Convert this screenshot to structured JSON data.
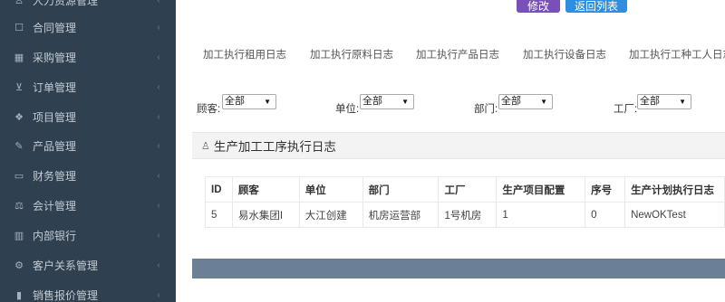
{
  "sidebar": {
    "items": [
      {
        "label": "人力资源管理",
        "icon": "user-icon",
        "glyph": "♙"
      },
      {
        "label": "合同管理",
        "icon": "document-icon",
        "glyph": "☐"
      },
      {
        "label": "采购管理",
        "icon": "archive-icon",
        "glyph": "▦"
      },
      {
        "label": "订单管理",
        "icon": "cart-icon",
        "glyph": "⊻"
      },
      {
        "label": "项目管理",
        "icon": "cubes-icon",
        "glyph": "❖"
      },
      {
        "label": "产品管理",
        "icon": "edit-icon",
        "glyph": "✎"
      },
      {
        "label": "财务管理",
        "icon": "money-icon",
        "glyph": "▭"
      },
      {
        "label": "会计管理",
        "icon": "balance-icon",
        "glyph": "⚖"
      },
      {
        "label": "内部银行",
        "icon": "bank-icon",
        "glyph": "▥"
      },
      {
        "label": "客户关系管理",
        "icon": "cogs-icon",
        "glyph": "⚙"
      },
      {
        "label": "销售报价管理",
        "icon": "chart-icon",
        "glyph": "▮"
      }
    ],
    "chevron": "‹"
  },
  "actions": {
    "edit": "修改",
    "back": "返回列表"
  },
  "tabs": [
    "加工执行租用日志",
    "加工执行原料日志",
    "加工执行产品日志",
    "加工执行设备日志",
    "加工执行工种工人日志"
  ],
  "filters": [
    {
      "label": "顾客:",
      "value": "全部"
    },
    {
      "label": "单位:",
      "value": "全部"
    },
    {
      "label": "部门:",
      "value": "全部"
    },
    {
      "label": "工厂:",
      "value": "全部"
    }
  ],
  "section": {
    "title": "生产加工工序执行日志",
    "icon": "user-icon"
  },
  "table": {
    "headers": [
      "ID",
      "顾客",
      "单位",
      "部门",
      "工厂",
      "生产项目配置",
      "序号",
      "生产计划执行日志"
    ],
    "rows": [
      [
        "5",
        "易水集团I",
        "大江创建",
        "机房运营部",
        "1号机房",
        "1",
        "0",
        "NewOKTest"
      ]
    ]
  },
  "colors": {
    "sidebar": "#2f4050",
    "edit_button": "#7a4fb8",
    "back_button": "#2e8fe0",
    "bottom_bar": "#6b7f96"
  }
}
